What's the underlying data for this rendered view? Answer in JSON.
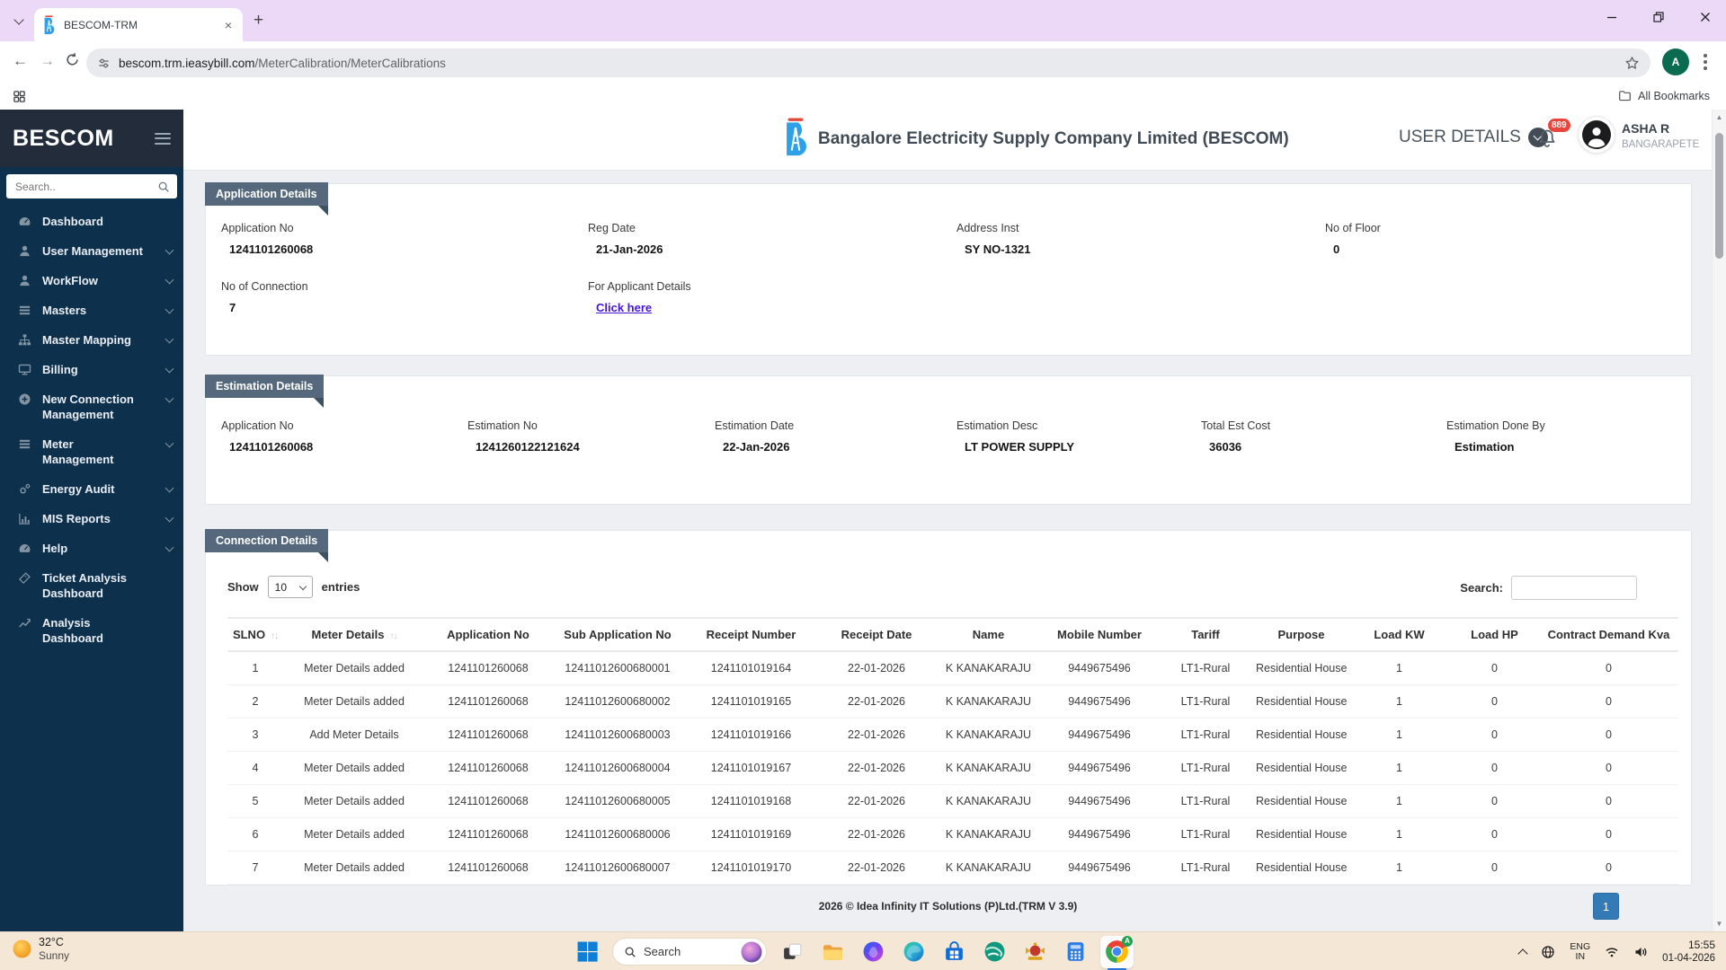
{
  "browser": {
    "tab_title": "BESCOM-TRM",
    "url_domain": "bescom.trm.ieasybill.com",
    "url_path": "/MeterCalibration/MeterCalibrations",
    "all_bookmarks_label": "All Bookmarks",
    "profile_initial": "A"
  },
  "sidebar": {
    "brand": "BESCOM",
    "search_placeholder": "Search..",
    "items": [
      {
        "label": "Dashboard",
        "icon": "gauge"
      },
      {
        "label": "User Management",
        "icon": "user",
        "expandable": true
      },
      {
        "label": "WorkFlow",
        "icon": "user",
        "expandable": true
      },
      {
        "label": "Masters",
        "icon": "list",
        "expandable": true
      },
      {
        "label": "Master Mapping",
        "icon": "sitemap",
        "expandable": true
      },
      {
        "label": "Billing",
        "icon": "monitor",
        "expandable": true
      },
      {
        "label": "New Connection Management",
        "icon": "plus-circle",
        "expandable": true
      },
      {
        "label": "Meter Management",
        "icon": "list",
        "expandable": true
      },
      {
        "label": "Energy Audit",
        "icon": "gears",
        "expandable": true
      },
      {
        "label": "MIS Reports",
        "icon": "chart-bar",
        "expandable": true
      },
      {
        "label": "Help",
        "icon": "gauge",
        "expandable": true
      },
      {
        "label": "Ticket Analysis Dashboard",
        "icon": "ticket"
      },
      {
        "label": "Analysis Dashboard",
        "icon": "chart-line"
      }
    ]
  },
  "header": {
    "company": "Bangalore Electricity Supply Company Limited (BESCOM)",
    "user_details_label": "USER DETAILS",
    "notification_count": "889",
    "user_name": "ASHA R",
    "user_location": "BANGARAPETE"
  },
  "sections": {
    "application": {
      "title": "Application Details",
      "fields": [
        {
          "label": "Application No",
          "value": "1241101260068",
          "interactable": "false"
        },
        {
          "label": "Reg Date",
          "value": "21-Jan-2026",
          "interactable": "false"
        },
        {
          "label": "Address Inst",
          "value": "SY NO-1321",
          "interactable": "false"
        },
        {
          "label": "No of Floor",
          "value": "0",
          "interactable": "false"
        },
        {
          "label": "No of Connection",
          "value": "7",
          "interactable": "false"
        },
        {
          "label": "For Applicant Details",
          "value": "Click here",
          "value_class": "link",
          "interactable": "true"
        }
      ]
    },
    "estimation": {
      "title": "Estimation Details",
      "fields": [
        {
          "label": "Application No",
          "value": "1241101260068",
          "interactable": "false"
        },
        {
          "label": "Estimation No",
          "value": "1241260122121624",
          "interactable": "false"
        },
        {
          "label": "Estimation Date",
          "value": "22-Jan-2026",
          "interactable": "false"
        },
        {
          "label": "Estimation Desc",
          "value": "LT POWER SUPPLY",
          "interactable": "false"
        },
        {
          "label": "Total Est Cost",
          "value": "36036",
          "interactable": "false"
        },
        {
          "label": "Estimation Done By",
          "value": "Estimation",
          "interactable": "false"
        }
      ]
    },
    "connection": {
      "title": "Connection Details",
      "show_label": "Show",
      "page_size": "10",
      "entries_label": "entries",
      "search_label": "Search:",
      "search_value": "",
      "columns": [
        {
          "label": "SLNO",
          "sortable": true
        },
        {
          "label": "Meter Details",
          "sortable": true
        },
        {
          "label": "Application No"
        },
        {
          "label": "Sub Application No"
        },
        {
          "label": "Receipt Number"
        },
        {
          "label": "Receipt Date"
        },
        {
          "label": "Name"
        },
        {
          "label": "Mobile Number"
        },
        {
          "label": "Tariff"
        },
        {
          "label": "Purpose"
        },
        {
          "label": "Load KW"
        },
        {
          "label": "Load HP"
        },
        {
          "label": "Contract Demand Kva"
        }
      ],
      "rows": [
        {
          "slno": "1",
          "meter": "Meter Details added",
          "meter_class": "added",
          "app": "1241101260068",
          "sub": "12411012600680001",
          "receipt": "1241101019164",
          "rdate": "22-01-2026",
          "name": "K KANAKARAJU",
          "mobile": "9449675496",
          "tariff": "LT1-Rural",
          "purpose": "Residential House",
          "kw": "1",
          "hp": "0",
          "kva": "0"
        },
        {
          "slno": "2",
          "meter": "Meter Details added",
          "meter_class": "added",
          "app": "1241101260068",
          "sub": "12411012600680002",
          "receipt": "1241101019165",
          "rdate": "22-01-2026",
          "name": "K KANAKARAJU",
          "mobile": "9449675496",
          "tariff": "LT1-Rural",
          "purpose": "Residential House",
          "kw": "1",
          "hp": "0",
          "kva": "0"
        },
        {
          "slno": "3",
          "meter": "Add Meter Details",
          "meter_class": "add",
          "app": "1241101260068",
          "sub": "12411012600680003",
          "receipt": "1241101019166",
          "rdate": "22-01-2026",
          "name": "K KANAKARAJU",
          "mobile": "9449675496",
          "tariff": "LT1-Rural",
          "purpose": "Residential House",
          "kw": "1",
          "hp": "0",
          "kva": "0"
        },
        {
          "slno": "4",
          "meter": "Meter Details added",
          "meter_class": "added",
          "app": "1241101260068",
          "sub": "12411012600680004",
          "receipt": "1241101019167",
          "rdate": "22-01-2026",
          "name": "K KANAKARAJU",
          "mobile": "9449675496",
          "tariff": "LT1-Rural",
          "purpose": "Residential House",
          "kw": "1",
          "hp": "0",
          "kva": "0"
        },
        {
          "slno": "5",
          "meter": "Meter Details added",
          "meter_class": "added",
          "app": "1241101260068",
          "sub": "12411012600680005",
          "receipt": "1241101019168",
          "rdate": "22-01-2026",
          "name": "K KANAKARAJU",
          "mobile": "9449675496",
          "tariff": "LT1-Rural",
          "purpose": "Residential House",
          "kw": "1",
          "hp": "0",
          "kva": "0"
        },
        {
          "slno": "6",
          "meter": "Meter Details added",
          "meter_class": "added",
          "app": "1241101260068",
          "sub": "12411012600680006",
          "receipt": "1241101019169",
          "rdate": "22-01-2026",
          "name": "K KANAKARAJU",
          "mobile": "9449675496",
          "tariff": "LT1-Rural",
          "purpose": "Residential House",
          "kw": "1",
          "hp": "0",
          "kva": "0"
        },
        {
          "slno": "7",
          "meter": "Meter Details added",
          "meter_class": "added",
          "app": "1241101260068",
          "sub": "12411012600680007",
          "receipt": "1241101019170",
          "rdate": "22-01-2026",
          "name": "K KANAKARAJU",
          "mobile": "9449675496",
          "tariff": "LT1-Rural",
          "purpose": "Residential House",
          "kw": "1",
          "hp": "0",
          "kva": "0"
        }
      ]
    }
  },
  "footer": {
    "copyright": "2026 © Idea Infinity IT Solutions (P)Ltd.(TRM V 3.9)",
    "page": "1"
  },
  "taskbar": {
    "weather_temp": "32°C",
    "weather_condition": "Sunny",
    "search_placeholder": "Search",
    "apps": [
      {
        "icon": "task-view"
      },
      {
        "icon": "file-explorer"
      },
      {
        "icon": "copilot"
      },
      {
        "icon": "edge"
      },
      {
        "icon": "microsoft-store"
      },
      {
        "icon": "internet-app"
      },
      {
        "icon": "govt-emblem"
      },
      {
        "icon": "calculator"
      }
    ],
    "chrome_badge": "A",
    "lang_primary": "ENG",
    "lang_secondary": "IN",
    "time": "15:55",
    "date": "01-04-2026"
  }
}
